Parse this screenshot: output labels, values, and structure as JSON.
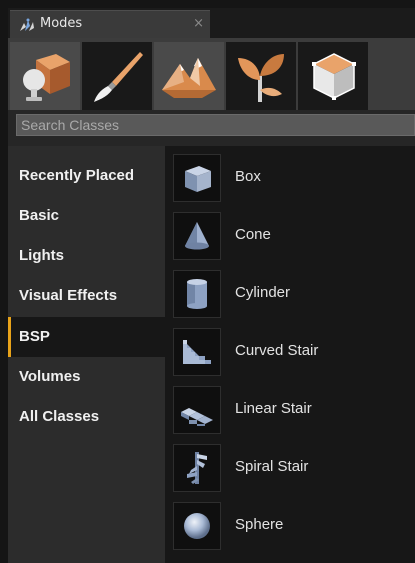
{
  "tab": {
    "title": "Modes",
    "close_glyph": "×",
    "icon": "modes-icon"
  },
  "modes": [
    {
      "name": "place",
      "icon": "place-mode-icon",
      "active": true
    },
    {
      "name": "paint",
      "icon": "paint-mode-icon",
      "active": false
    },
    {
      "name": "landscape",
      "icon": "landscape-mode-icon",
      "active": true
    },
    {
      "name": "foliage",
      "icon": "foliage-mode-icon",
      "active": false
    },
    {
      "name": "geometry",
      "icon": "geometry-mode-icon",
      "active": false
    }
  ],
  "search": {
    "placeholder": "Search Classes",
    "value": ""
  },
  "categories": [
    {
      "label": "Recently Placed",
      "active": false
    },
    {
      "label": "Basic",
      "active": false
    },
    {
      "label": "Lights",
      "active": false
    },
    {
      "label": "Visual Effects",
      "active": false
    },
    {
      "label": "BSP",
      "active": true
    },
    {
      "label": "Volumes",
      "active": false
    },
    {
      "label": "All Classes",
      "active": false
    }
  ],
  "items": [
    {
      "label": "Box",
      "icon": "box-icon"
    },
    {
      "label": "Cone",
      "icon": "cone-icon"
    },
    {
      "label": "Cylinder",
      "icon": "cylinder-icon"
    },
    {
      "label": "Curved Stair",
      "icon": "curved-stair-icon"
    },
    {
      "label": "Linear Stair",
      "icon": "linear-stair-icon"
    },
    {
      "label": "Spiral Stair",
      "icon": "spiral-stair-icon"
    },
    {
      "label": "Sphere",
      "icon": "sphere-icon"
    }
  ],
  "colors": {
    "accent": "#e8a31a",
    "panel": "#262626",
    "list_bg": "#171717"
  }
}
